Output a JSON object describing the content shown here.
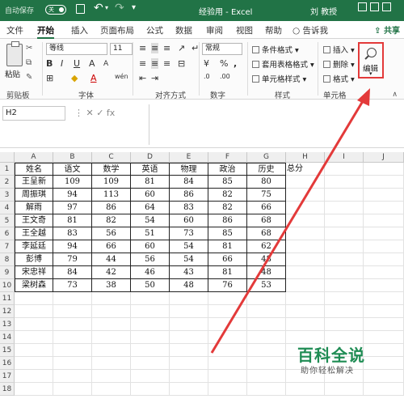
{
  "titlebar": {
    "autosave": "自动保存",
    "toggle": "关",
    "title": "经验用 - Excel",
    "user": "刘 教授"
  },
  "tabs": [
    "文件",
    "开始",
    "插入",
    "页面布局",
    "公式",
    "数据",
    "审阅",
    "视图",
    "帮助"
  ],
  "tell_me": "告诉我",
  "share": "共享",
  "ribbon": {
    "paste": "粘贴",
    "font_name": "等线",
    "font_size": "11",
    "number_format": "常规",
    "conditional_format": "条件格式",
    "format_as_table": "套用表格格式",
    "cell_styles": "单元格样式",
    "insert": "插入",
    "delete": "删除",
    "format": "格式",
    "edit": "编辑",
    "groups": [
      "剪贴板",
      "字体",
      "对齐方式",
      "数字",
      "样式",
      "单元格"
    ]
  },
  "formula_bar": {
    "name_box": "H2",
    "formula": ""
  },
  "sheet": {
    "columns": [
      "A",
      "B",
      "C",
      "D",
      "E",
      "F",
      "G",
      "H",
      "I",
      "J"
    ],
    "row_numbers": [
      "1",
      "2",
      "3",
      "4",
      "5",
      "6",
      "7",
      "8",
      "9",
      "10",
      "11",
      "12",
      "13",
      "14",
      "15",
      "16",
      "17",
      "18"
    ],
    "headers": [
      "姓名",
      "语文",
      "数学",
      "英语",
      "物理",
      "政治",
      "历史",
      "总分"
    ],
    "rows": [
      [
        "王呈新",
        "109",
        "109",
        "81",
        "84",
        "85",
        "80"
      ],
      [
        "周振琪",
        "94",
        "113",
        "60",
        "86",
        "82",
        "75"
      ],
      [
        "解雨",
        "97",
        "86",
        "64",
        "83",
        "82",
        "66"
      ],
      [
        "王文奇",
        "81",
        "82",
        "54",
        "60",
        "86",
        "68"
      ],
      [
        "王全越",
        "83",
        "56",
        "51",
        "73",
        "85",
        "68"
      ],
      [
        "李延廷",
        "94",
        "66",
        "60",
        "54",
        "81",
        "62"
      ],
      [
        "彭博",
        "79",
        "44",
        "56",
        "54",
        "66",
        "48"
      ],
      [
        "宋忠祥",
        "84",
        "42",
        "46",
        "43",
        "81",
        "48"
      ],
      [
        "梁树森",
        "73",
        "38",
        "50",
        "48",
        "76",
        "53"
      ]
    ]
  },
  "watermark": {
    "title": "百科全说",
    "subtitle": "助你轻松解决"
  },
  "colors": {
    "excel_green": "#217346",
    "highlight_red": "#e33a3a"
  }
}
